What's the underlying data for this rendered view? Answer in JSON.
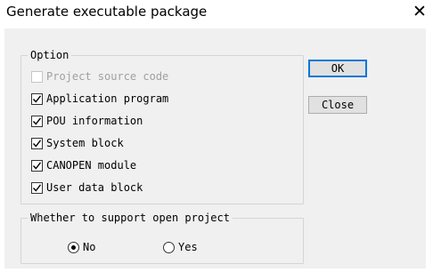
{
  "window": {
    "title": "Generate executable package",
    "close_glyph": "✕"
  },
  "option_group": {
    "legend": "Option",
    "items": [
      {
        "label": "Project source code",
        "checked": false,
        "disabled": true
      },
      {
        "label": "Application program",
        "checked": true,
        "disabled": false
      },
      {
        "label": "POU information",
        "checked": true,
        "disabled": false
      },
      {
        "label": "System block",
        "checked": true,
        "disabled": false
      },
      {
        "label": "CANOPEN module",
        "checked": true,
        "disabled": false
      },
      {
        "label": "User data block",
        "checked": true,
        "disabled": false
      }
    ]
  },
  "buttons": {
    "ok": "OK",
    "close": "Close"
  },
  "open_project_group": {
    "legend": "Whether to support open project",
    "options": [
      {
        "label": "No",
        "selected": true
      },
      {
        "label": "Yes",
        "selected": false
      }
    ]
  },
  "colors": {
    "accent": "#0078d7",
    "dialog_bg": "#f0f0f0"
  }
}
